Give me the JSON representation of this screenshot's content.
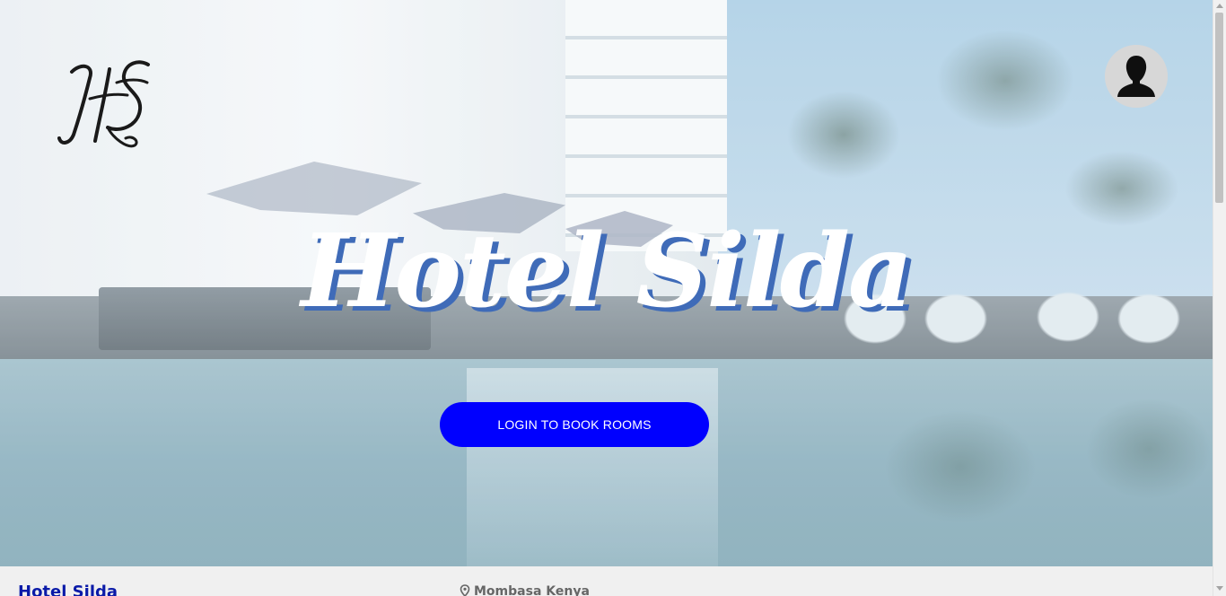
{
  "hero": {
    "title": "Hotel Silda",
    "login_button_label": "LOGIN TO BOOK ROOMS",
    "title_shadow_color": "#3f6bb8",
    "button_color": "#0000ff"
  },
  "header": {
    "logo_icon": "hs-monogram-logo",
    "avatar_icon": "user-silhouette-icon"
  },
  "footer": {
    "brand": "Hotel Silda",
    "location": "Mombasa Kenya",
    "location_icon": "map-pin-icon",
    "brand_color": "#0a1aa8"
  }
}
